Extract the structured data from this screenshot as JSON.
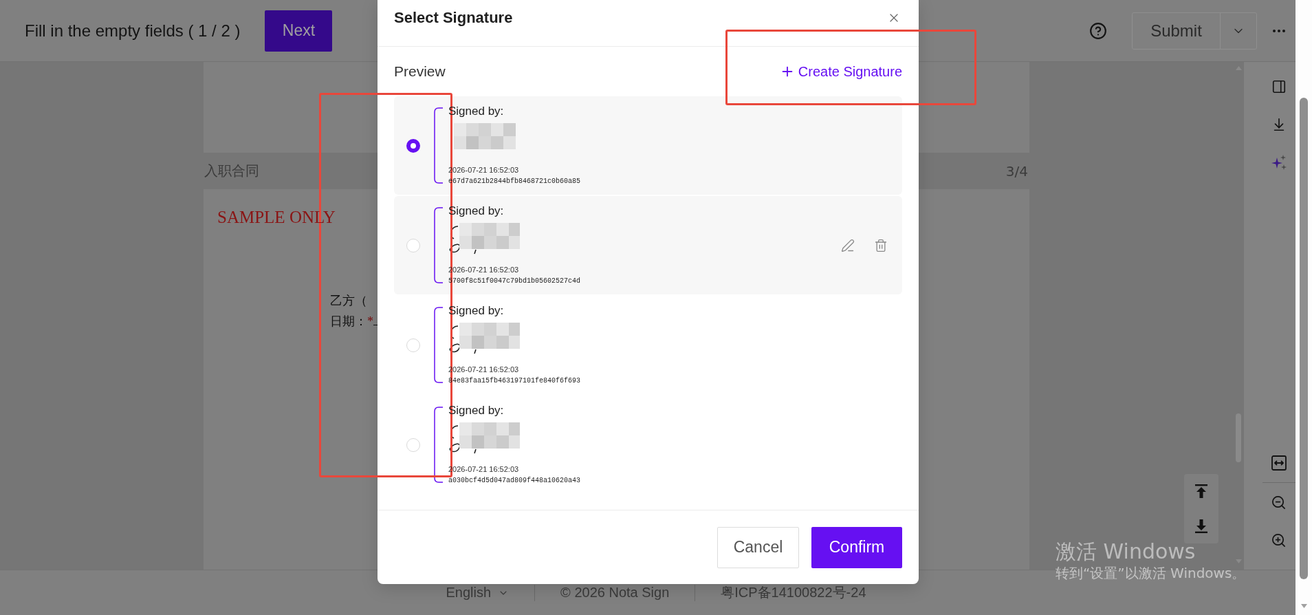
{
  "top_bar": {
    "progress": "Fill in the empty fields ( 1 / 2 )",
    "next_button": "Next",
    "submit_button": "Submit"
  },
  "document": {
    "page_label": "入职合同",
    "page_counter": "3/4",
    "stamp": "SAMPLE ONLY",
    "party_line": "乙方（",
    "date_label": "日期：",
    "required_mark": "*"
  },
  "dialog": {
    "title": "Select Signature",
    "section_label": "Preview",
    "create_link": "Create Signature",
    "signatures": [
      {
        "label": "Signed by:",
        "date": "2026-07-21 16:52:03",
        "hash": "e67d7a621b2844bfb8468721c0b60a85",
        "selected": true,
        "hovered": false
      },
      {
        "label": "Signed by:",
        "date": "2026-07-21 16:52:03",
        "hash": "5700f8c51f0047c79bd1b05602527c4d",
        "selected": false,
        "hovered": true
      },
      {
        "label": "Signed by:",
        "date": "2026-07-21 16:52:03",
        "hash": "84e83faa15fb463197101fe840f6f693",
        "selected": false,
        "hovered": false
      },
      {
        "label": "Signed by:",
        "date": "2026-07-21 16:52:03",
        "hash": "a030bcf4d5d047ad809f448a10620a43",
        "selected": false,
        "hovered": false
      }
    ],
    "buttons": [
      {
        "kind": "secondary",
        "label": "Cancel"
      },
      {
        "kind": "primary",
        "label": "Confirm"
      }
    ]
  },
  "footer": {
    "language": "English",
    "copyright": "© 2026 Nota Sign",
    "license": "粤ICP备14100822号-24"
  },
  "system_watermark": {
    "title": "激活 Windows",
    "subtitle": "转到“设置”以激活 Windows。"
  }
}
